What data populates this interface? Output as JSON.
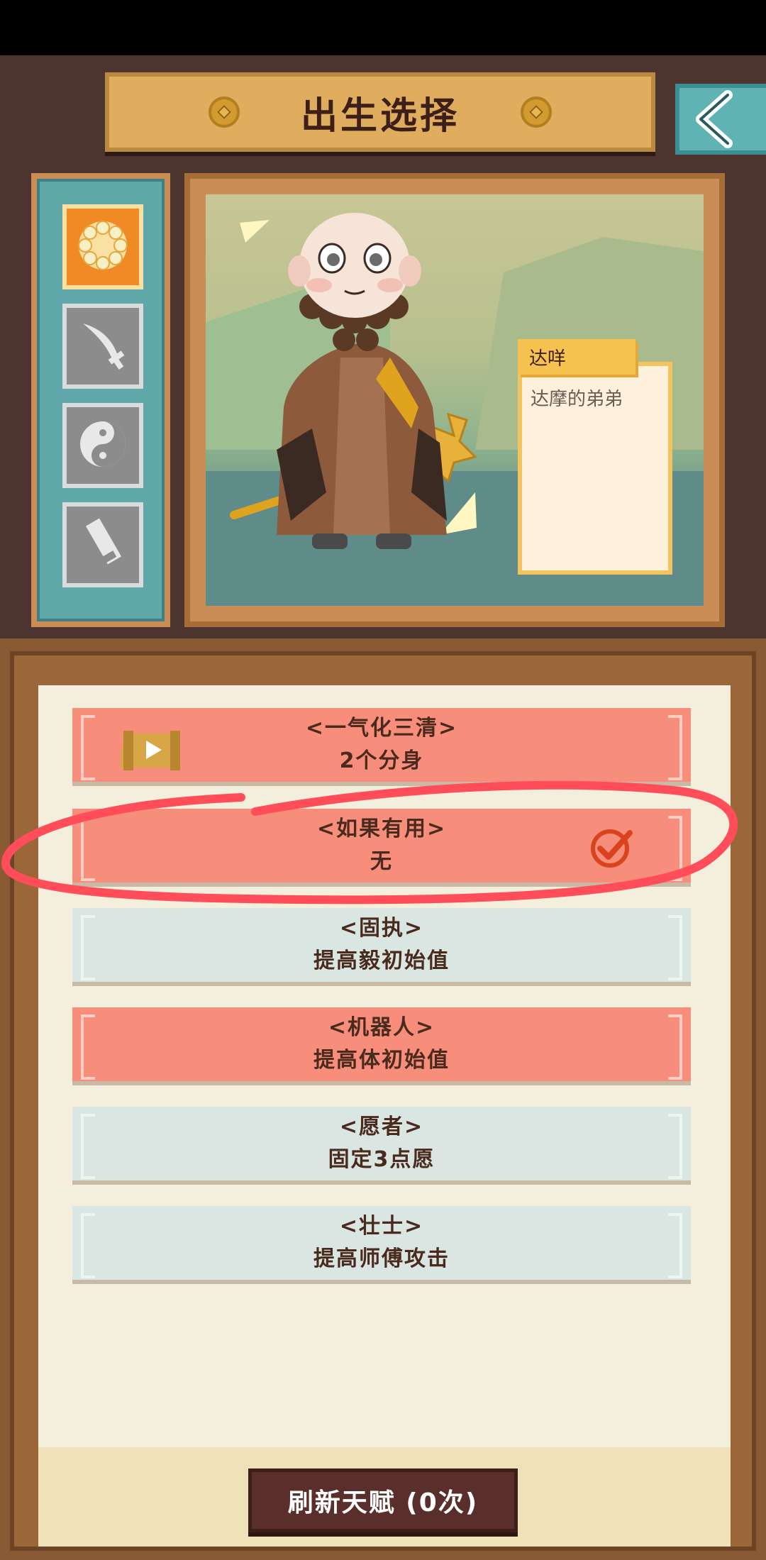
{
  "header": {
    "title": "出生选择"
  },
  "rail": {
    "items": [
      "orb-icon",
      "sword-icon",
      "yin-yang-icon",
      "scroll-icon"
    ]
  },
  "character": {
    "name": "达咩",
    "description": "达摩的弟弟"
  },
  "talents": [
    {
      "name": "<一气化三清>",
      "desc": "2个分身",
      "color": "red",
      "video": true
    },
    {
      "name": "<如果有用>",
      "desc": "无",
      "color": "red",
      "selected": true
    },
    {
      "name": "<固执>",
      "desc": "提高毅初始值",
      "color": "blue"
    },
    {
      "name": "<机器人>",
      "desc": "提高体初始值",
      "color": "red"
    },
    {
      "name": "<愿者>",
      "desc": "固定3点愿",
      "color": "blue"
    },
    {
      "name": "<壮士>",
      "desc": "提高师傅攻击",
      "color": "blue"
    }
  ],
  "refresh": {
    "label": "刷新天赋 (0次)"
  },
  "colors": {
    "accent_red": "#f78e7c",
    "accent_blue": "#d9e6e2",
    "panel_brown": "#4e342e",
    "highlight": "#ff4d5a"
  }
}
